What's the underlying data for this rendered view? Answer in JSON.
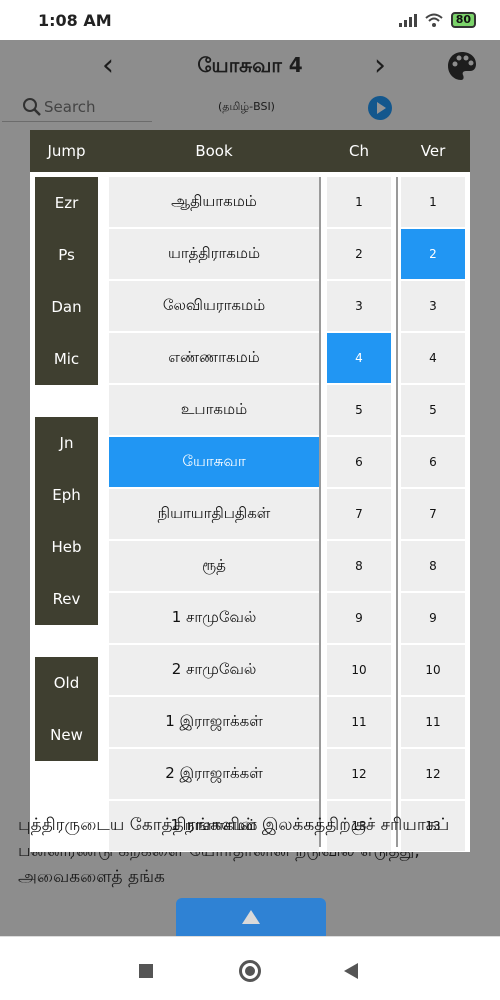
{
  "status": {
    "time": "1:08 AM",
    "battery": "80"
  },
  "header": {
    "title": "யோசுவா 4",
    "prev": "‹",
    "next": "›"
  },
  "search": {
    "placeholder": "Search",
    "version": "(தமிழ்-BSI)"
  },
  "background_lines": [
    "புத்திரருடைய கோத்திரங்களின் இலக்கத்திற்குச் சரியாகப்",
    "பன்னிரண்டு கற்களை யோர்தானின் நடுவில் எடுத்து,",
    "அவைகளைத் தங்க"
  ],
  "picker": {
    "headers": {
      "jump": "Jump",
      "book": "Book",
      "ch": "Ch",
      "ver": "Ver"
    },
    "jump_groups": [
      [
        "Ezr",
        "Ps",
        "Dan",
        "Mic"
      ],
      [
        "Jn",
        "Eph",
        "Heb",
        "Rev"
      ],
      [
        "Old",
        "New"
      ]
    ],
    "books": [
      "ஆதியாகமம்",
      "யாத்திராகமம்",
      "லேவியராகமம்",
      "எண்ணாகமம்",
      "உபாகமம்",
      "யோசுவா",
      "நியாயாதிபதிகள்",
      "ரூத்",
      "1 சாமுவேல்",
      "2 சாமுவேல்",
      "1 இராஜாக்கள்",
      "2 இராஜாக்கள்",
      "1 நாளாகமம்"
    ],
    "chapters": [
      "1",
      "2",
      "3",
      "4",
      "5",
      "6",
      "7",
      "8",
      "9",
      "10",
      "11",
      "12",
      "13"
    ],
    "verses": [
      "1",
      "2",
      "3",
      "4",
      "5",
      "6",
      "7",
      "8",
      "9",
      "10",
      "11",
      "12",
      "13"
    ],
    "selected_book": "யோசுவா",
    "selected_chapter": "4",
    "selected_verse": "2"
  },
  "colors": {
    "accent": "#2196f3",
    "dark": "#3f3f30"
  }
}
